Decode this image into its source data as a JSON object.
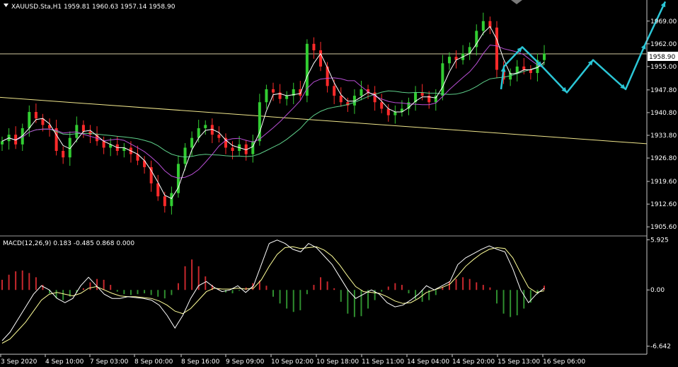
{
  "header": {
    "symbol_line": "XAUUSD.Sta,H1  1959.81 1960.63 1957.14 1958.90",
    "menu_icon": "triangle-down-icon"
  },
  "chart_data": [
    {
      "type": "line",
      "title": "XAUUSD.Sta,H1",
      "subtitle": "1959.81 1960.63 1957.14 1958.90",
      "ylim": [
        1905.6,
        1974.0
      ],
      "y_ticks": [
        "1969.00",
        "1962.00",
        "1955.00",
        "1947.80",
        "1940.80",
        "1933.80",
        "1926.80",
        "1919.60",
        "1912.60",
        "1905.60"
      ],
      "y_tick_values": [
        1969.0,
        1962.0,
        1955.0,
        1947.8,
        1940.8,
        1933.8,
        1926.8,
        1919.6,
        1912.6,
        1905.6
      ],
      "current_price_label": "1958.90",
      "current_price": 1958.9,
      "x_tick_labels": [
        "3 Sep 2020",
        "4 Sep 10:00",
        "7 Sep 03:00",
        "8 Sep 00:00",
        "8 Sep 16:00",
        "9 Sep 09:00",
        "10 Sep 02:00",
        "10 Sep 18:00",
        "11 Sep 11:00",
        "14 Sep 04:00",
        "14 Sep 20:00",
        "15 Sep 13:00",
        "16 Sep 06:00"
      ],
      "price_close_series": [
        1932,
        1934,
        1931,
        1936,
        1941,
        1939,
        1937,
        1936,
        1929,
        1927,
        1933,
        1937,
        1935,
        1934,
        1932,
        1930,
        1931,
        1929,
        1930,
        1928,
        1926,
        1924,
        1919,
        1915,
        1912,
        1916,
        1925,
        1930,
        1933,
        1936,
        1937,
        1934,
        1933,
        1930,
        1929,
        1931,
        1928,
        1932,
        1944,
        1948,
        1947,
        1945,
        1946,
        1948,
        1946,
        1962,
        1960,
        1955,
        1949,
        1946,
        1944,
        1943,
        1946,
        1948,
        1947,
        1944,
        1942,
        1940,
        1941,
        1942,
        1944,
        1947,
        1946,
        1944,
        1946,
        1956,
        1958,
        1957,
        1959,
        1961,
        1966,
        1969,
        1967,
        1954,
        1951,
        1953,
        1955,
        1954,
        1953,
        1957,
        1959
      ],
      "trendline": {
        "start": 1945.5,
        "end": 1931.2
      },
      "forecast_points": [
        1948,
        1955,
        1961,
        1955,
        1947,
        1957,
        1948,
        1962,
        1975
      ],
      "series": [],
      "grid": false
    },
    {
      "type": "bar",
      "title": "MACD(12,26,9) 0.183 -0.485 0.868 0.000",
      "ylim": [
        -6.642,
        5.925
      ],
      "y_ticks": [
        "5.925",
        "0.00",
        "-6.642"
      ],
      "y_tick_values": [
        5.925,
        0.0,
        -6.642
      ],
      "histogram": [
        1.2,
        1.8,
        2.2,
        2.3,
        2.0,
        1.5,
        0.6,
        -0.4,
        -1.0,
        -1.2,
        -0.8,
        -0.3,
        0.2,
        0.9,
        1.3,
        1.2,
        0.6,
        -0.2,
        -0.5,
        -0.6,
        -0.5,
        -0.4,
        -0.6,
        -0.8,
        -1.0,
        -0.6,
        0.8,
        2.8,
        3.6,
        2.8,
        1.6,
        0.6,
        0.1,
        -0.3,
        -0.4,
        -0.1,
        0.3,
        0.8,
        1.1,
        0.5,
        -0.8,
        -1.6,
        -2.2,
        -2.6,
        -2.4,
        -0.5,
        0.6,
        1.5,
        1.0,
        0.2,
        -1.4,
        -2.8,
        -3.2,
        -3.1,
        -2.2,
        -1.2,
        -0.2,
        0.4,
        0.8,
        0.6,
        -0.4,
        -1.1,
        -1.4,
        -1.2,
        -0.6,
        0.4,
        1.0,
        1.3,
        1.5,
        1.3,
        0.9,
        0.6,
        0.3,
        -1.6,
        -2.8,
        -3.2,
        -3.0,
        -2.2,
        -1.5,
        -0.5,
        0.5
      ],
      "macd_line": [
        -6.0,
        -5.0,
        -3.5,
        -2.0,
        -0.5,
        0.5,
        0.0,
        -1.0,
        -1.5,
        -1.0,
        0.5,
        1.5,
        0.5,
        -0.5,
        -1.0,
        -1.0,
        -0.8,
        -0.9,
        -1.0,
        -1.2,
        -1.8,
        -3.0,
        -4.5,
        -3.0,
        -1.0,
        0.5,
        1.0,
        0.3,
        -0.2,
        0.0,
        0.5,
        -0.3,
        0.5,
        3.0,
        5.5,
        5.9,
        5.5,
        4.8,
        4.5,
        5.5,
        5.0,
        4.0,
        3.0,
        1.5,
        0.0,
        -1.0,
        -0.5,
        0.0,
        -0.5,
        -1.5,
        -2.0,
        -1.8,
        -1.2,
        -0.5,
        0.5,
        0.0,
        0.5,
        1.0,
        3.0,
        3.8,
        4.3,
        4.8,
        5.2,
        4.8,
        4.5,
        2.5,
        0.0,
        -1.5,
        -0.5,
        0.2
      ],
      "signal_line": [
        -6.3,
        -5.8,
        -4.8,
        -3.8,
        -2.5,
        -1.2,
        -0.5,
        -0.3,
        -0.5,
        -0.7,
        -0.4,
        0.2,
        0.4,
        0.0,
        -0.4,
        -0.7,
        -0.8,
        -0.8,
        -0.9,
        -1.0,
        -1.3,
        -1.8,
        -2.5,
        -2.8,
        -2.2,
        -1.2,
        -0.2,
        0.2,
        0.1,
        0.1,
        0.2,
        0.1,
        0.2,
        1.2,
        2.8,
        4.2,
        5.0,
        5.1,
        4.9,
        5.0,
        5.1,
        4.7,
        4.0,
        2.9,
        1.6,
        0.4,
        -0.2,
        -0.3,
        -0.4,
        -0.8,
        -1.3,
        -1.6,
        -1.5,
        -1.0,
        -0.3,
        0.0,
        0.3,
        0.7,
        1.7,
        2.8,
        3.6,
        4.3,
        4.8,
        5.0,
        4.9,
        3.8,
        2.0,
        0.3,
        -0.3,
        -0.1
      ],
      "grid": false
    }
  ],
  "colors": {
    "background": "#000000",
    "bull": "#32cd32",
    "bear": "#ff2a2a",
    "text": "#ffffff",
    "axis": "#c8c8c8",
    "ma_fast": "#ffffff",
    "ma_mid": "#b94fd6",
    "ma_slow": "#5ecf8a",
    "trendline": "#f0e68c",
    "price_line": "#d2c7a0",
    "forecast": "#2bc6d6",
    "macd_hist_pos": "#c8282d",
    "macd_hist_neg": "#2f8f2f",
    "macd_line": "#ffffff",
    "signal_line": "#ffff99"
  }
}
